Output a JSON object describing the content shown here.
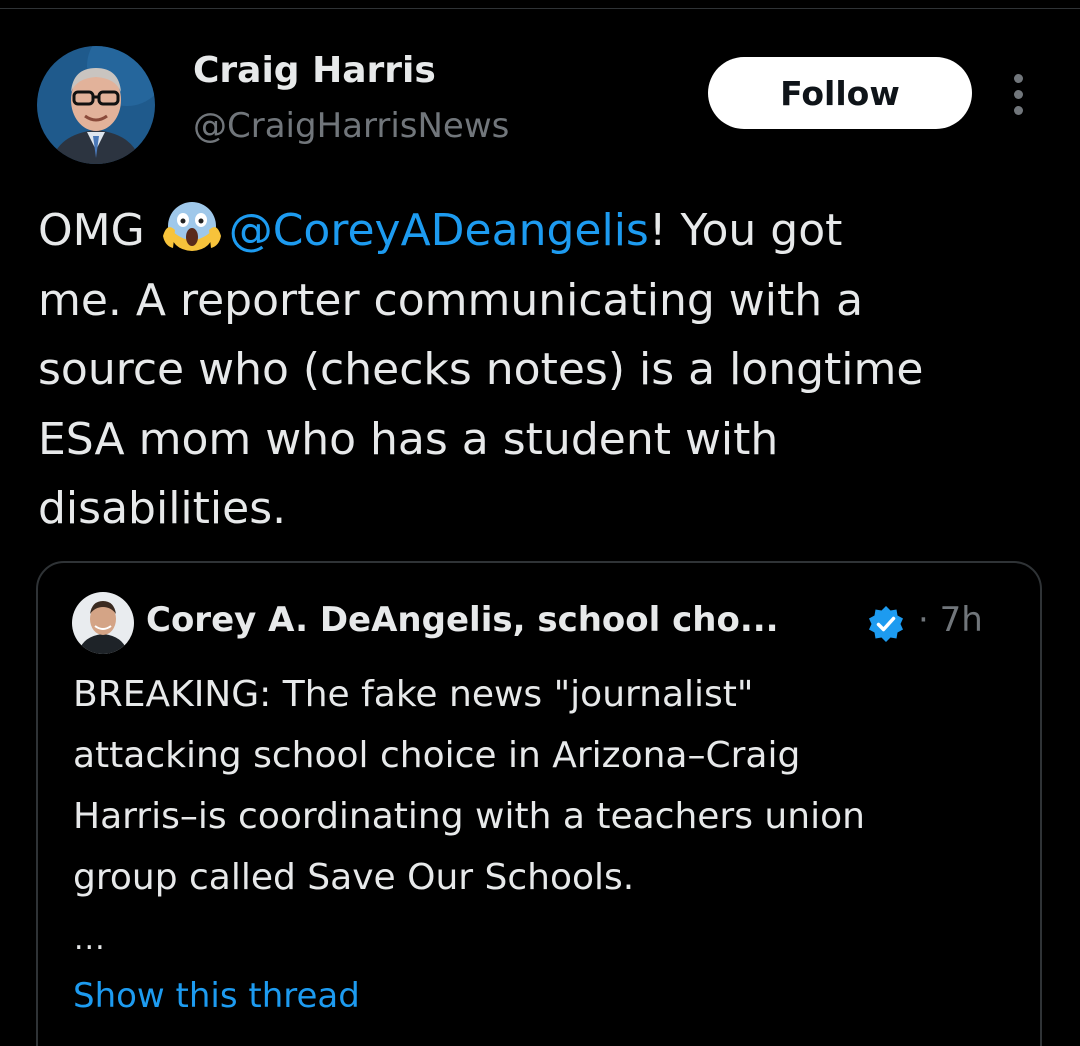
{
  "tweet": {
    "author": {
      "name": "Craig Harris",
      "handle": "@CraigHarrisNews"
    },
    "follow_label": "Follow",
    "body": {
      "line1_pre": "OMG ",
      "emoji": "screaming-face-emoji",
      "mention": "@CoreyADeangelis",
      "line1_post": "! You got",
      "line2": "me. A reporter communicating with a",
      "line3": "source who (checks notes) is a longtime",
      "line4": "ESA mom who has a student with",
      "line5": "disabilities."
    }
  },
  "quote": {
    "author_name": "Corey A. DeAngelis, school cho...",
    "verified": true,
    "time": "· 7h",
    "lines": [
      "BREAKING: The fake news \"journalist\"",
      "attacking school choice in Arizona–Craig",
      "Harris–is coordinating with a teachers union",
      "group called Save Our Schools."
    ],
    "ellipsis": "...",
    "show_thread": "Show this thread"
  },
  "colors": {
    "background": "#000000",
    "text": "#e7e9ea",
    "secondary": "#71767b",
    "accent": "#1d9bf0",
    "border": "#2f3336"
  },
  "icons": [
    "avatar",
    "more-icon",
    "verified-badge-icon"
  ]
}
